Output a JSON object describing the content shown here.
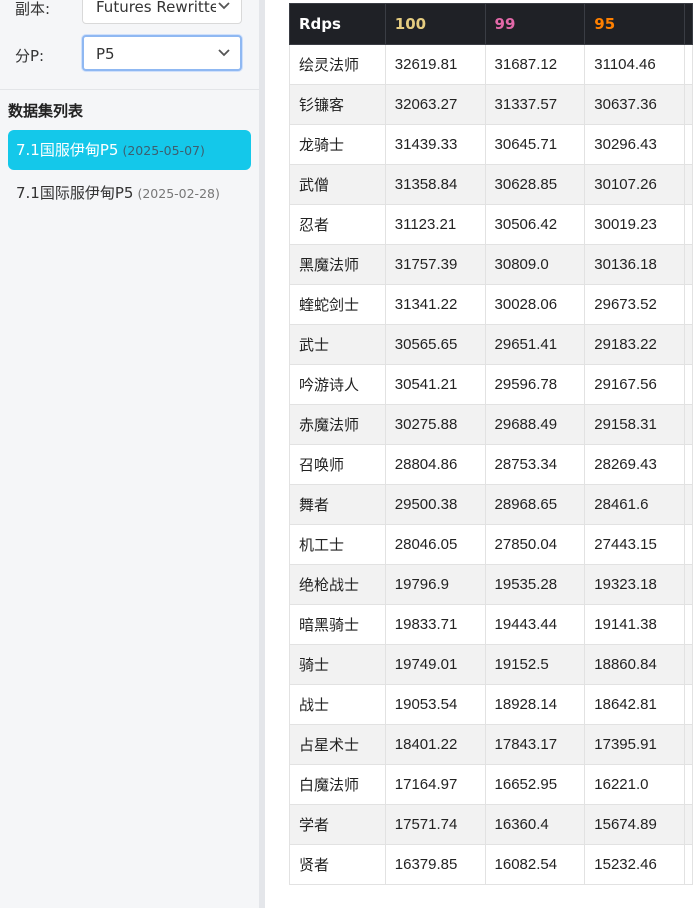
{
  "sidebar": {
    "instance_label": "副本:",
    "instance_value": "Futures Rewritten",
    "phase_label": "分P:",
    "phase_value": "P5",
    "dataset_title": "数据集列表",
    "datasets": [
      {
        "name": "7.1国服伊甸P5",
        "date": "(2025-05-07)",
        "active": true
      },
      {
        "name": "7.1国际服伊甸P5",
        "date": "(2025-02-28)",
        "active": false
      }
    ]
  },
  "table": {
    "headers": [
      {
        "label": "Rdps",
        "color": "#ffffff"
      },
      {
        "label": "100",
        "color": "#e5cc80"
      },
      {
        "label": "99",
        "color": "#e268a8"
      },
      {
        "label": "95",
        "color": "#ff8000"
      }
    ],
    "rows": [
      {
        "job": "绘灵法师",
        "v100": "32619.81",
        "v99": "31687.12",
        "v95": "31104.46"
      },
      {
        "job": "钐镰客",
        "v100": "32063.27",
        "v99": "31337.57",
        "v95": "30637.36"
      },
      {
        "job": "龙骑士",
        "v100": "31439.33",
        "v99": "30645.71",
        "v95": "30296.43"
      },
      {
        "job": "武僧",
        "v100": "31358.84",
        "v99": "30628.85",
        "v95": "30107.26"
      },
      {
        "job": "忍者",
        "v100": "31123.21",
        "v99": "30506.42",
        "v95": "30019.23"
      },
      {
        "job": "黑魔法师",
        "v100": "31757.39",
        "v99": "30809.0",
        "v95": "30136.18"
      },
      {
        "job": "蝰蛇剑士",
        "v100": "31341.22",
        "v99": "30028.06",
        "v95": "29673.52"
      },
      {
        "job": "武士",
        "v100": "30565.65",
        "v99": "29651.41",
        "v95": "29183.22"
      },
      {
        "job": "吟游诗人",
        "v100": "30541.21",
        "v99": "29596.78",
        "v95": "29167.56"
      },
      {
        "job": "赤魔法师",
        "v100": "30275.88",
        "v99": "29688.49",
        "v95": "29158.31"
      },
      {
        "job": "召唤师",
        "v100": "28804.86",
        "v99": "28753.34",
        "v95": "28269.43"
      },
      {
        "job": "舞者",
        "v100": "29500.38",
        "v99": "28968.65",
        "v95": "28461.6"
      },
      {
        "job": "机工士",
        "v100": "28046.05",
        "v99": "27850.04",
        "v95": "27443.15"
      },
      {
        "job": "绝枪战士",
        "v100": "19796.9",
        "v99": "19535.28",
        "v95": "19323.18"
      },
      {
        "job": "暗黑骑士",
        "v100": "19833.71",
        "v99": "19443.44",
        "v95": "19141.38"
      },
      {
        "job": "骑士",
        "v100": "19749.01",
        "v99": "19152.5",
        "v95": "18860.84"
      },
      {
        "job": "战士",
        "v100": "19053.54",
        "v99": "18928.14",
        "v95": "18642.81"
      },
      {
        "job": "占星术士",
        "v100": "18401.22",
        "v99": "17843.17",
        "v95": "17395.91"
      },
      {
        "job": "白魔法师",
        "v100": "17164.97",
        "v99": "16652.95",
        "v95": "16221.0"
      },
      {
        "job": "学者",
        "v100": "17571.74",
        "v99": "16360.4",
        "v95": "15674.89"
      },
      {
        "job": "贤者",
        "v100": "16379.85",
        "v99": "16082.54",
        "v95": "15232.46"
      }
    ]
  }
}
